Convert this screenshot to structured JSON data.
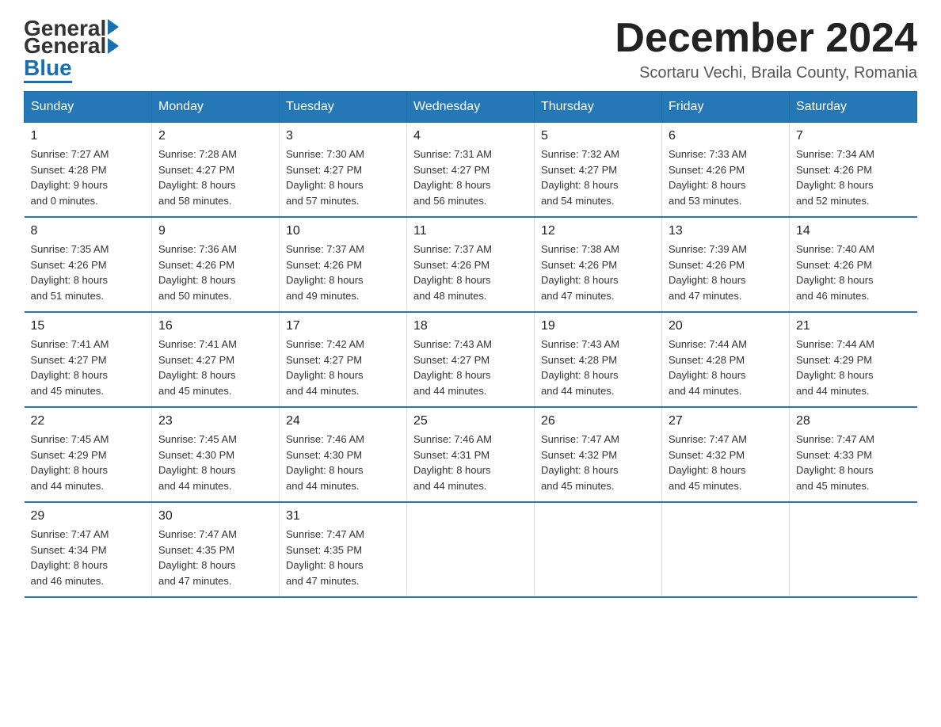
{
  "header": {
    "logo_general": "General",
    "logo_blue": "Blue",
    "main_title": "December 2024",
    "subtitle": "Scortaru Vechi, Braila County, Romania"
  },
  "days_of_week": [
    "Sunday",
    "Monday",
    "Tuesday",
    "Wednesday",
    "Thursday",
    "Friday",
    "Saturday"
  ],
  "weeks": [
    [
      {
        "day": "1",
        "info": "Sunrise: 7:27 AM\nSunset: 4:28 PM\nDaylight: 9 hours\nand 0 minutes."
      },
      {
        "day": "2",
        "info": "Sunrise: 7:28 AM\nSunset: 4:27 PM\nDaylight: 8 hours\nand 58 minutes."
      },
      {
        "day": "3",
        "info": "Sunrise: 7:30 AM\nSunset: 4:27 PM\nDaylight: 8 hours\nand 57 minutes."
      },
      {
        "day": "4",
        "info": "Sunrise: 7:31 AM\nSunset: 4:27 PM\nDaylight: 8 hours\nand 56 minutes."
      },
      {
        "day": "5",
        "info": "Sunrise: 7:32 AM\nSunset: 4:27 PM\nDaylight: 8 hours\nand 54 minutes."
      },
      {
        "day": "6",
        "info": "Sunrise: 7:33 AM\nSunset: 4:26 PM\nDaylight: 8 hours\nand 53 minutes."
      },
      {
        "day": "7",
        "info": "Sunrise: 7:34 AM\nSunset: 4:26 PM\nDaylight: 8 hours\nand 52 minutes."
      }
    ],
    [
      {
        "day": "8",
        "info": "Sunrise: 7:35 AM\nSunset: 4:26 PM\nDaylight: 8 hours\nand 51 minutes."
      },
      {
        "day": "9",
        "info": "Sunrise: 7:36 AM\nSunset: 4:26 PM\nDaylight: 8 hours\nand 50 minutes."
      },
      {
        "day": "10",
        "info": "Sunrise: 7:37 AM\nSunset: 4:26 PM\nDaylight: 8 hours\nand 49 minutes."
      },
      {
        "day": "11",
        "info": "Sunrise: 7:37 AM\nSunset: 4:26 PM\nDaylight: 8 hours\nand 48 minutes."
      },
      {
        "day": "12",
        "info": "Sunrise: 7:38 AM\nSunset: 4:26 PM\nDaylight: 8 hours\nand 47 minutes."
      },
      {
        "day": "13",
        "info": "Sunrise: 7:39 AM\nSunset: 4:26 PM\nDaylight: 8 hours\nand 47 minutes."
      },
      {
        "day": "14",
        "info": "Sunrise: 7:40 AM\nSunset: 4:26 PM\nDaylight: 8 hours\nand 46 minutes."
      }
    ],
    [
      {
        "day": "15",
        "info": "Sunrise: 7:41 AM\nSunset: 4:27 PM\nDaylight: 8 hours\nand 45 minutes."
      },
      {
        "day": "16",
        "info": "Sunrise: 7:41 AM\nSunset: 4:27 PM\nDaylight: 8 hours\nand 45 minutes."
      },
      {
        "day": "17",
        "info": "Sunrise: 7:42 AM\nSunset: 4:27 PM\nDaylight: 8 hours\nand 44 minutes."
      },
      {
        "day": "18",
        "info": "Sunrise: 7:43 AM\nSunset: 4:27 PM\nDaylight: 8 hours\nand 44 minutes."
      },
      {
        "day": "19",
        "info": "Sunrise: 7:43 AM\nSunset: 4:28 PM\nDaylight: 8 hours\nand 44 minutes."
      },
      {
        "day": "20",
        "info": "Sunrise: 7:44 AM\nSunset: 4:28 PM\nDaylight: 8 hours\nand 44 minutes."
      },
      {
        "day": "21",
        "info": "Sunrise: 7:44 AM\nSunset: 4:29 PM\nDaylight: 8 hours\nand 44 minutes."
      }
    ],
    [
      {
        "day": "22",
        "info": "Sunrise: 7:45 AM\nSunset: 4:29 PM\nDaylight: 8 hours\nand 44 minutes."
      },
      {
        "day": "23",
        "info": "Sunrise: 7:45 AM\nSunset: 4:30 PM\nDaylight: 8 hours\nand 44 minutes."
      },
      {
        "day": "24",
        "info": "Sunrise: 7:46 AM\nSunset: 4:30 PM\nDaylight: 8 hours\nand 44 minutes."
      },
      {
        "day": "25",
        "info": "Sunrise: 7:46 AM\nSunset: 4:31 PM\nDaylight: 8 hours\nand 44 minutes."
      },
      {
        "day": "26",
        "info": "Sunrise: 7:47 AM\nSunset: 4:32 PM\nDaylight: 8 hours\nand 45 minutes."
      },
      {
        "day": "27",
        "info": "Sunrise: 7:47 AM\nSunset: 4:32 PM\nDaylight: 8 hours\nand 45 minutes."
      },
      {
        "day": "28",
        "info": "Sunrise: 7:47 AM\nSunset: 4:33 PM\nDaylight: 8 hours\nand 45 minutes."
      }
    ],
    [
      {
        "day": "29",
        "info": "Sunrise: 7:47 AM\nSunset: 4:34 PM\nDaylight: 8 hours\nand 46 minutes."
      },
      {
        "day": "30",
        "info": "Sunrise: 7:47 AM\nSunset: 4:35 PM\nDaylight: 8 hours\nand 47 minutes."
      },
      {
        "day": "31",
        "info": "Sunrise: 7:47 AM\nSunset: 4:35 PM\nDaylight: 8 hours\nand 47 minutes."
      },
      {
        "day": "",
        "info": ""
      },
      {
        "day": "",
        "info": ""
      },
      {
        "day": "",
        "info": ""
      },
      {
        "day": "",
        "info": ""
      }
    ]
  ]
}
